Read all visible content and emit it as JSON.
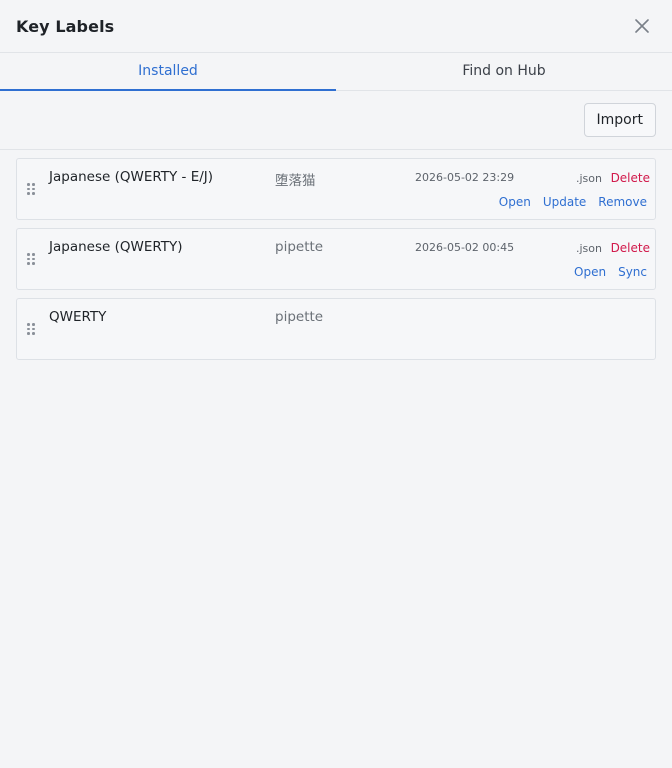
{
  "dialog": {
    "title": "Key Labels"
  },
  "tabs": [
    {
      "label": "Installed",
      "active": true
    },
    {
      "label": "Find on Hub",
      "active": false
    }
  ],
  "toolbar": {
    "import_label": "Import"
  },
  "items": [
    {
      "name": "Japanese (QWERTY - E/J)",
      "author": "堕落猫",
      "date": "2026-05-02 23:29",
      "ext": ".json",
      "delete_label": "Delete",
      "actions": [
        "Open",
        "Update",
        "Remove"
      ]
    },
    {
      "name": "Japanese (QWERTY)",
      "author": "pipette",
      "date": "2026-05-02 00:45",
      "ext": ".json",
      "delete_label": "Delete",
      "actions": [
        "Open",
        "Sync"
      ]
    },
    {
      "name": "QWERTY",
      "author": "pipette"
    }
  ],
  "icons": {
    "close": "close-icon",
    "drag": "drag-handle-icon"
  },
  "colors": {
    "accent": "#2f6fd1",
    "danger": "#d1184a",
    "background": "#f4f5f7"
  }
}
